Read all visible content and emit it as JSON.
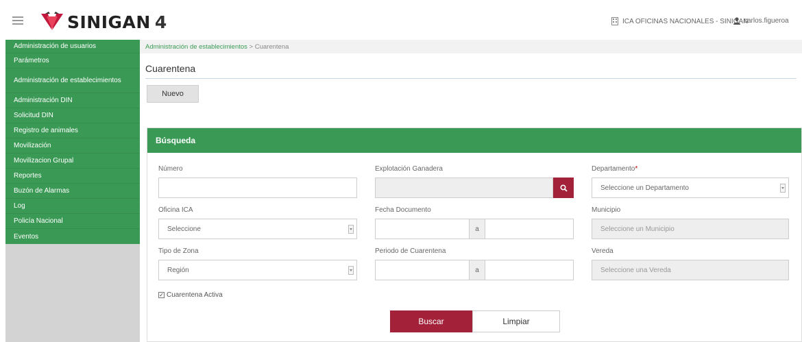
{
  "app": {
    "name": "SINIGAN",
    "version": "4"
  },
  "header": {
    "office": "ICA OFICINAS NACIONALES - SINIGAN",
    "user": "carlos.figueroa"
  },
  "sidebar": {
    "items": [
      {
        "label": "Administración de usuarios"
      },
      {
        "label": "Parámetros"
      },
      {
        "label": "Administración de establecimientos"
      },
      {
        "label": "Administración DIN"
      },
      {
        "label": "Solicitud DIN"
      },
      {
        "label": "Registro de animales"
      },
      {
        "label": "Movilización"
      },
      {
        "label": "Movilizacion Grupal"
      },
      {
        "label": "Reportes"
      },
      {
        "label": "Buzón de Alarmas"
      },
      {
        "label": "Log"
      },
      {
        "label": "Policía Nacional"
      },
      {
        "label": "Eventos"
      }
    ]
  },
  "breadcrumb": {
    "parent": "Administración de establecimientos",
    "separator": " > ",
    "current": "Cuarentena"
  },
  "page": {
    "title": "Cuarentena",
    "new_button": "Nuevo"
  },
  "search_panel": {
    "title": "Búsqueda",
    "fields": {
      "numero": {
        "label": "Número",
        "value": ""
      },
      "explotacion": {
        "label": "Explotación Ganadera",
        "value": ""
      },
      "departamento": {
        "label": "Departamento",
        "required_mark": "*",
        "value": "Seleccione un Departamento"
      },
      "oficina": {
        "label": "Oficina ICA",
        "value": "Seleccione"
      },
      "fecha": {
        "label": "Fecha Documento",
        "separator": "a",
        "from": "",
        "to": ""
      },
      "municipio": {
        "label": "Municipio",
        "value": "Seleccione un Municipio"
      },
      "tipo_zona": {
        "label": "Tipo de Zona",
        "value": "Región"
      },
      "periodo": {
        "label": "Periodo de Cuarentena",
        "separator": "a",
        "from": "",
        "to": ""
      },
      "vereda": {
        "label": "Vereda",
        "value": "Seleccione una Vereda"
      }
    },
    "active_checkbox": {
      "label": "Cuarentena Activa",
      "checked": true
    },
    "buttons": {
      "search": "Buscar",
      "clear": "Limpiar"
    }
  },
  "colors": {
    "primary_green": "#3a9a55",
    "accent_red": "#a3223a"
  }
}
